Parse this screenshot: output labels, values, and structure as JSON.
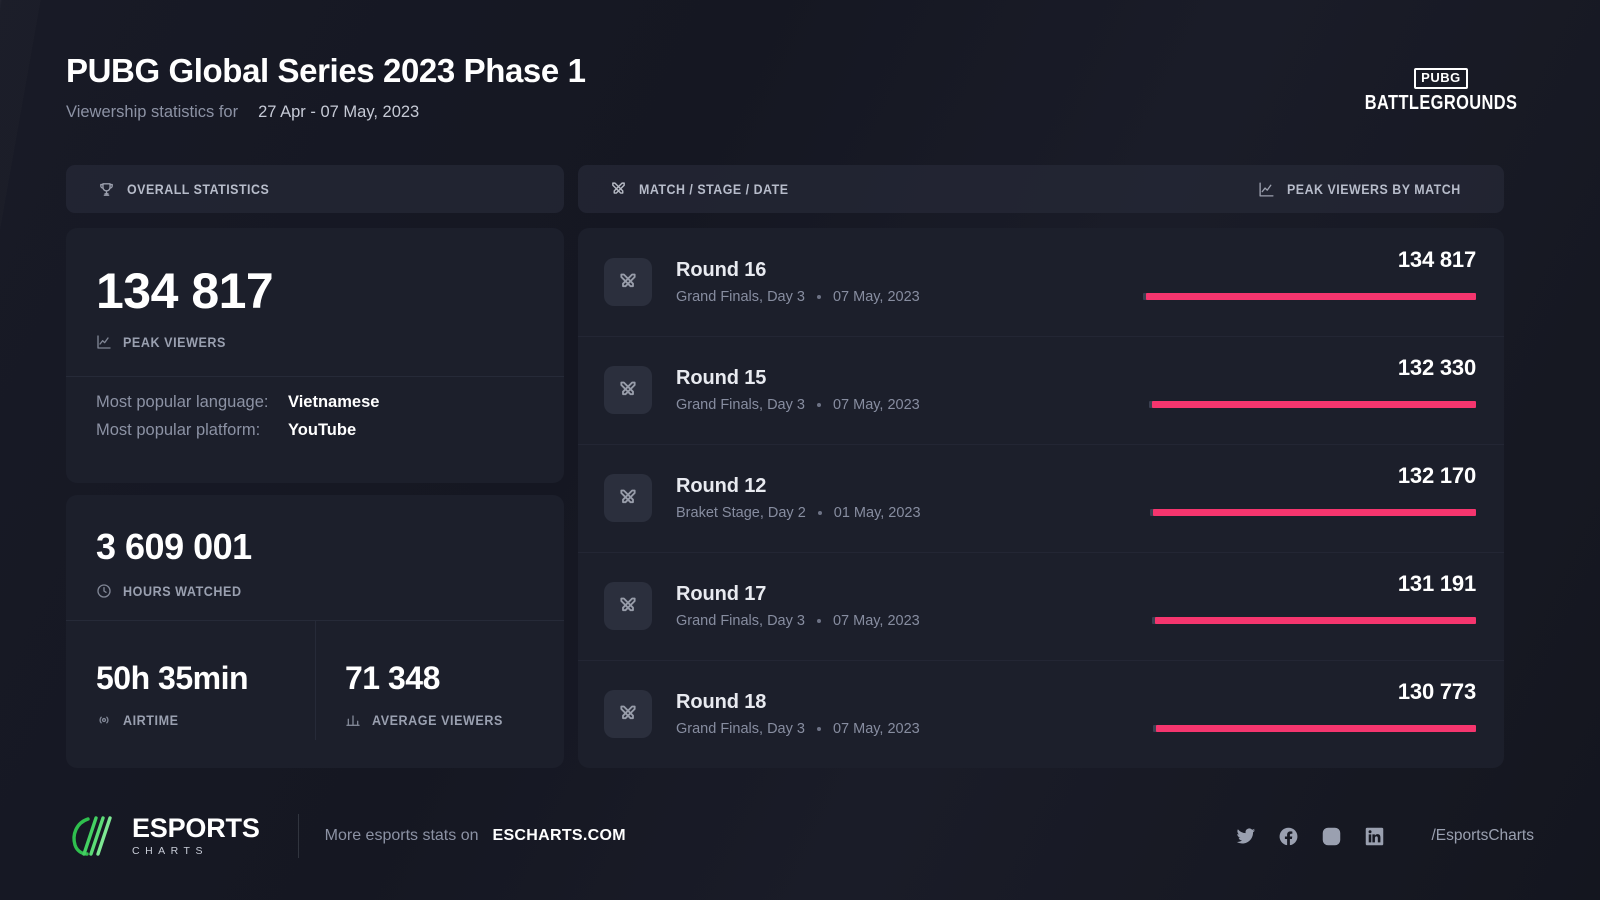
{
  "header": {
    "title": "PUBG Global Series 2023 Phase 1",
    "subtitle_prefix": "Viewership statistics for",
    "date_range": "27 Apr - 07 May, 2023",
    "game_logo_badge": "PUBG",
    "game_logo_word": "BATTLEGROUNDS"
  },
  "columns": {
    "left_header": "OVERALL STATISTICS",
    "left_header_icon": "trophy-icon",
    "right_header": "MATCH / STAGE / DATE",
    "right_header_icon": "swords-icon",
    "right_header_secondary": "PEAK VIEWERS BY MATCH",
    "right_header_secondary_icon": "chart-icon"
  },
  "overall": {
    "peak_viewers": {
      "value": "134 817",
      "label": "PEAK VIEWERS",
      "icon": "chart-icon"
    },
    "most_popular_language_key": "Most popular language:",
    "most_popular_language_value": "Vietnamese",
    "most_popular_platform_key": "Most popular platform:",
    "most_popular_platform_value": "YouTube",
    "hours_watched": {
      "value": "3 609 001",
      "label": "HOURS WATCHED",
      "icon": "clock-icon"
    },
    "airtime": {
      "value": "50h 35min",
      "label": "AIRTIME",
      "icon": "broadcast-icon"
    },
    "average_viewers": {
      "value": "71 348",
      "label": "AVERAGE VIEWERS",
      "icon": "avg-chart-icon"
    }
  },
  "chart_data": {
    "type": "bar",
    "title": "PEAK VIEWERS BY MATCH",
    "orientation": "horizontal",
    "categories": [
      "Round 16",
      "Round 15",
      "Round 12",
      "Round 17",
      "Round 18"
    ],
    "values": [
      134817,
      132330,
      132170,
      131191,
      130773
    ],
    "value_labels": [
      "134 817",
      "132 330",
      "132 170",
      "131 191",
      "130 773"
    ],
    "xlabel": "",
    "ylabel": "",
    "bar_color": "#f5356e",
    "grid": false,
    "legend": false
  },
  "matches": [
    {
      "name": "Round 16",
      "stage": "Grand Finals, Day 3",
      "date": "07 May, 2023",
      "value": "134 817",
      "value_num": 134817,
      "bar_pct": 100.0,
      "icon": "swords-icon"
    },
    {
      "name": "Round 15",
      "stage": "Grand Finals, Day 3",
      "date": "07 May, 2023",
      "value": "132 330",
      "value_num": 132330,
      "bar_pct": 98.2,
      "icon": "swords-icon"
    },
    {
      "name": "Round 12",
      "stage": "Braket Stage, Day 2",
      "date": "01 May, 2023",
      "value": "132 170",
      "value_num": 132170,
      "bar_pct": 98.0,
      "icon": "swords-icon"
    },
    {
      "name": "Round 17",
      "stage": "Grand Finals, Day 3",
      "date": "07 May, 2023",
      "value": "131 191",
      "value_num": 131191,
      "bar_pct": 97.3,
      "icon": "swords-icon"
    },
    {
      "name": "Round 18",
      "stage": "Grand Finals, Day 3",
      "date": "07 May, 2023",
      "value": "130 773",
      "value_num": 130773,
      "bar_pct": 97.0,
      "icon": "swords-icon"
    }
  ],
  "footer": {
    "brand_top": "ESPORTS",
    "brand_bottom": "CHARTS",
    "more_text": "More esports stats on",
    "site": "ESCHARTS.COM",
    "handle": "/EsportsCharts",
    "socials": [
      "twitter-icon",
      "facebook-icon",
      "instagram-icon",
      "linkedin-icon"
    ]
  },
  "colors": {
    "accent": "#f5356e",
    "background": "#14161f",
    "card": "#1c1f2b",
    "brand_green": "#3fc65a"
  }
}
